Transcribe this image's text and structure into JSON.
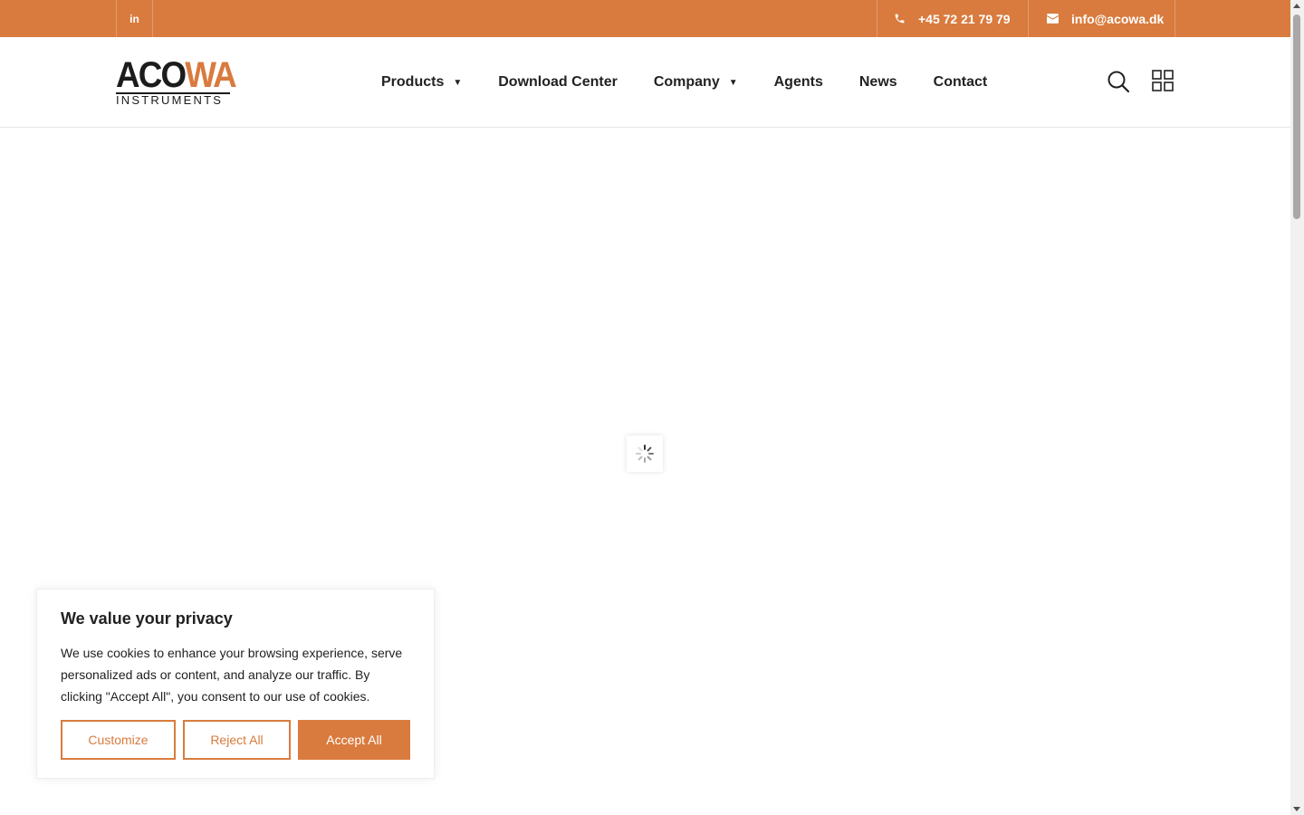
{
  "topbar": {
    "social_label": "in",
    "phone": "+45 72 21 79 79",
    "email": "info@acowa.dk"
  },
  "logo": {
    "part1": "ACO",
    "part2": "WA",
    "subtitle": "INSTRUMENTS"
  },
  "nav": {
    "items": [
      {
        "label": "Products",
        "has_dropdown": true
      },
      {
        "label": "Download Center",
        "has_dropdown": false
      },
      {
        "label": "Company",
        "has_dropdown": true
      },
      {
        "label": "Agents",
        "has_dropdown": false
      },
      {
        "label": "News",
        "has_dropdown": false
      },
      {
        "label": "Contact",
        "has_dropdown": false
      }
    ],
    "caret": "▼"
  },
  "header_icons": [
    "search-icon",
    "grid-menu-icon"
  ],
  "cookie": {
    "title": "We value your privacy",
    "text": "We use cookies to enhance your browsing experience, serve personalized ads or content, and analyze our traffic. By clicking \"Accept All\", you consent to our use of cookies.",
    "customize_label": "Customize",
    "reject_label": "Reject All",
    "accept_label": "Accept All"
  },
  "colors": {
    "brand": "#d97b3e",
    "text": "#222222"
  }
}
